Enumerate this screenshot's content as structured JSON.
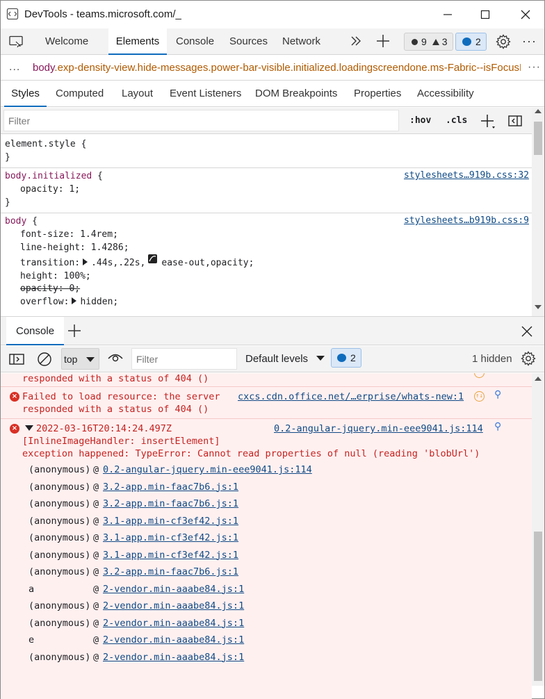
{
  "window": {
    "title": "DevTools - teams.microsoft.com/_"
  },
  "main_tabs": [
    {
      "label": "Welcome"
    },
    {
      "label": "Elements"
    },
    {
      "label": "Console"
    },
    {
      "label": "Sources"
    },
    {
      "label": "Network"
    }
  ],
  "issues": {
    "errors": "9",
    "warnings": "3",
    "messages": "2"
  },
  "breadcrumb": {
    "dots": "...",
    "tag": "body",
    "classes": ".exp-density-view.hide-messages.power-bar-visible.initialized.loadingscreendone.ms-Fabric--isFocusH"
  },
  "style_tabs": [
    {
      "label": "Styles"
    },
    {
      "label": "Computed"
    },
    {
      "label": "Layout"
    },
    {
      "label": "Event Listeners"
    },
    {
      "label": "DOM Breakpoints"
    },
    {
      "label": "Properties"
    },
    {
      "label": "Accessibility"
    }
  ],
  "styles_filter": {
    "placeholder": "Filter",
    "hov": ":hov",
    "cls": ".cls"
  },
  "rules": {
    "element_style": {
      "selector": "element.style {",
      "close": "}"
    },
    "initialized": {
      "selector": "body.initialized",
      "brace": " {",
      "source": "stylesheets…919b.css:32",
      "prop": "opacity",
      "value": "1;",
      "close": "}"
    },
    "body": {
      "selector": "body",
      "brace": " {",
      "source": "stylesheets…b919b.css:9",
      "font_size": {
        "name": "font-size",
        "value": "1.4rem;"
      },
      "line_height": {
        "name": "line-height",
        "value": "1.4286;"
      },
      "transition": {
        "name": "transition",
        "value1": ".44s,.22s,",
        "value2": "ease-out,opacity;"
      },
      "height": {
        "name": "height",
        "value": "100%;"
      },
      "opacity": {
        "name": "opacity",
        "value": "0;"
      },
      "overflow": {
        "name": "overflow",
        "value": "hidden;"
      }
    }
  },
  "drawer": {
    "tab": "Console"
  },
  "console_toolbar": {
    "context": "top",
    "filter_placeholder": "Filter",
    "levels": "Default levels",
    "msg_count": "2",
    "hidden": "1 hidden"
  },
  "messages": {
    "partial": {
      "text": "responded with a status of 404 ()"
    },
    "resource": {
      "line1": "Failed to load resource: the server",
      "line2": "responded with a status of 404 ()",
      "source": "cxcs.cdn.office.net/…erprise/whats-new:1"
    },
    "exception": {
      "timestamp": "2022-03-16T20:14:24.497Z",
      "source": "0.2-angular-jquery.min-eee9041.js:114",
      "line2": "[InlineImageHandler: insertElement]",
      "line3": "exception happened: TypeError: Cannot read properties of null (reading 'blobUrl')",
      "stack": [
        {
          "fn": "(anonymous)",
          "src": "0.2-angular-jquery.min-eee9041.js:114"
        },
        {
          "fn": "(anonymous)",
          "src": "3.2-app.min-faac7b6.js:1"
        },
        {
          "fn": "(anonymous)",
          "src": "3.2-app.min-faac7b6.js:1"
        },
        {
          "fn": "(anonymous)",
          "src": "3.1-app.min-cf3ef42.js:1"
        },
        {
          "fn": "(anonymous)",
          "src": "3.1-app.min-cf3ef42.js:1"
        },
        {
          "fn": "(anonymous)",
          "src": "3.1-app.min-cf3ef42.js:1"
        },
        {
          "fn": "(anonymous)",
          "src": "3.2-app.min-faac7b6.js:1"
        },
        {
          "fn": "a",
          "src": "2-vendor.min-aaabe84.js:1"
        },
        {
          "fn": "(anonymous)",
          "src": "2-vendor.min-aaabe84.js:1"
        },
        {
          "fn": "(anonymous)",
          "src": "2-vendor.min-aaabe84.js:1"
        },
        {
          "fn": "e",
          "src": "2-vendor.min-aaabe84.js:1"
        },
        {
          "fn": "(anonymous)",
          "src": "2-vendor.min-aaabe84.js:1"
        }
      ]
    }
  },
  "prompt": ">"
}
